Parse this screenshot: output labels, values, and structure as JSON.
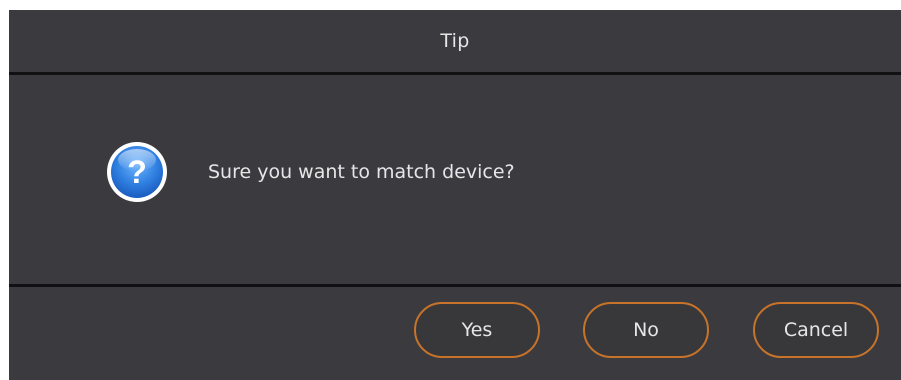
{
  "dialog": {
    "title": "Tip",
    "message": "Sure you want to match device?",
    "icon": "question-icon",
    "buttons": {
      "yes": "Yes",
      "no": "No",
      "cancel": "Cancel"
    },
    "colors": {
      "background": "#3b3b3f",
      "divider": "#111113",
      "text": "#e6e6e6",
      "button_border": "#c8732a",
      "icon_blue": "#2f7fe0"
    }
  }
}
